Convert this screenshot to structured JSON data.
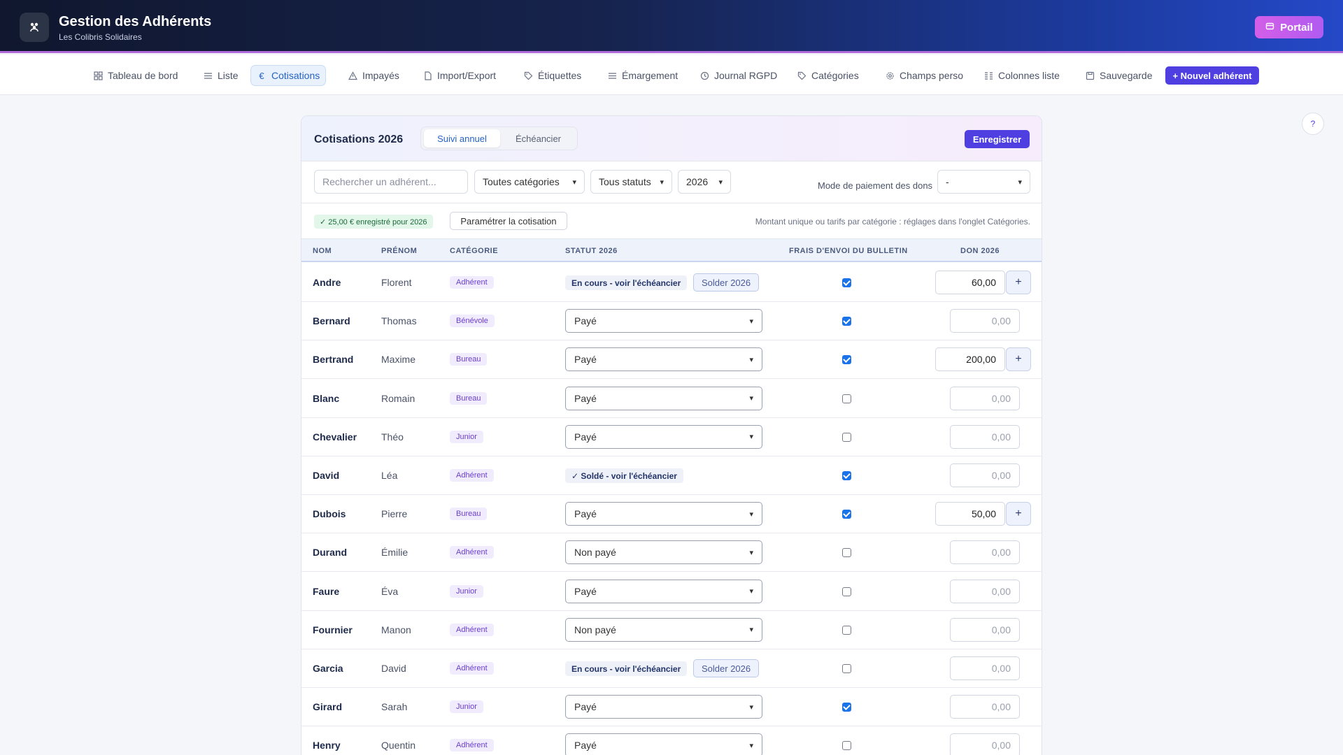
{
  "header": {
    "title": "Gestion des Adhérents",
    "subtitle": "Les Colibris Solidaires",
    "portal_label": "Portail"
  },
  "nav": [
    {
      "label": "Tableau de bord",
      "icon": "grid-icon"
    },
    {
      "label": "Liste",
      "icon": "list-icon"
    },
    {
      "label": "Cotisations",
      "icon": "euro-icon",
      "active": true
    },
    {
      "label": "Impayés",
      "icon": "warning-icon"
    },
    {
      "label": "Import/Export",
      "icon": "file-icon"
    },
    {
      "label": "Étiquettes",
      "icon": "tag-icon"
    },
    {
      "label": "Émargement",
      "icon": "list-icon"
    },
    {
      "label": "Journal RGPD",
      "icon": "history-icon"
    },
    {
      "label": "Catégories",
      "icon": "tag-icon"
    },
    {
      "label": "Champs perso",
      "icon": "gear-icon"
    },
    {
      "label": "Colonnes liste",
      "icon": "columns-icon"
    },
    {
      "label": "Sauvegarde",
      "icon": "save-icon"
    }
  ],
  "new_member_label": "+ Nouvel adhérent",
  "help_label": "?",
  "card": {
    "title": "Cotisations 2026",
    "tab_annual": "Suivi annuel",
    "tab_schedule": "Échéancier",
    "save_label": "Enregistrer"
  },
  "filters": {
    "search_placeholder": "Rechercher un adhérent...",
    "category": "Toutes catégories",
    "status": "Tous statuts",
    "year": "2026",
    "payment_mode_label": "Mode de paiement des dons",
    "payment_mode": "-"
  },
  "info": {
    "badge": "✓ 25,00 € enregistré pour 2026",
    "param_label": "Paramétrer la cotisation",
    "note": "Montant unique ou tarifs par catégorie : réglages dans l'onglet Catégories."
  },
  "columns": {
    "nom": "NOM",
    "prenom": "PRÉNOM",
    "categorie": "CATÉGORIE",
    "statut": "STATUT 2026",
    "frais": "FRAIS D'ENVOI DU BULLETIN",
    "don": "DON 2026"
  },
  "solder_label": "Solder 2026",
  "rows": [
    {
      "nom": "Andre",
      "prenom": "Florent",
      "cat": "Adhérent",
      "statut": "En cours - voir l'échéancier",
      "type": "badge",
      "solder": true,
      "frais": true,
      "don": "60,00",
      "plus": true
    },
    {
      "nom": "Bernard",
      "prenom": "Thomas",
      "cat": "Bénévole",
      "statut": "Payé",
      "type": "select",
      "frais": true,
      "don": "0,00",
      "plus": false
    },
    {
      "nom": "Bertrand",
      "prenom": "Maxime",
      "cat": "Bureau",
      "statut": "Payé",
      "type": "select",
      "frais": true,
      "don": "200,00",
      "plus": true
    },
    {
      "nom": "Blanc",
      "prenom": "Romain",
      "cat": "Bureau",
      "statut": "Payé",
      "type": "select",
      "frais": false,
      "don": "0,00",
      "plus": false
    },
    {
      "nom": "Chevalier",
      "prenom": "Théo",
      "cat": "Junior",
      "statut": "Payé",
      "type": "select",
      "frais": false,
      "don": "0,00",
      "plus": false
    },
    {
      "nom": "David",
      "prenom": "Léa",
      "cat": "Adhérent",
      "statut": "✓ Soldé - voir l'échéancier",
      "type": "badge",
      "solder": false,
      "frais": true,
      "don": "0,00",
      "plus": false
    },
    {
      "nom": "Dubois",
      "prenom": "Pierre",
      "cat": "Bureau",
      "statut": "Payé",
      "type": "select",
      "frais": true,
      "don": "50,00",
      "plus": true
    },
    {
      "nom": "Durand",
      "prenom": "Émilie",
      "cat": "Adhérent",
      "statut": "Non payé",
      "type": "select",
      "frais": false,
      "don": "0,00",
      "plus": false
    },
    {
      "nom": "Faure",
      "prenom": "Éva",
      "cat": "Junior",
      "statut": "Payé",
      "type": "select",
      "frais": false,
      "don": "0,00",
      "plus": false
    },
    {
      "nom": "Fournier",
      "prenom": "Manon",
      "cat": "Adhérent",
      "statut": "Non payé",
      "type": "select",
      "frais": false,
      "don": "0,00",
      "plus": false
    },
    {
      "nom": "Garcia",
      "prenom": "David",
      "cat": "Adhérent",
      "statut": "En cours - voir l'échéancier",
      "type": "badge",
      "solder": true,
      "frais": false,
      "don": "0,00",
      "plus": false
    },
    {
      "nom": "Girard",
      "prenom": "Sarah",
      "cat": "Junior",
      "statut": "Payé",
      "type": "select",
      "frais": true,
      "don": "0,00",
      "plus": false
    },
    {
      "nom": "Henry",
      "prenom": "Quentin",
      "cat": "Adhérent",
      "statut": "Payé",
      "type": "select",
      "frais": false,
      "don": "0,00",
      "plus": false
    }
  ]
}
